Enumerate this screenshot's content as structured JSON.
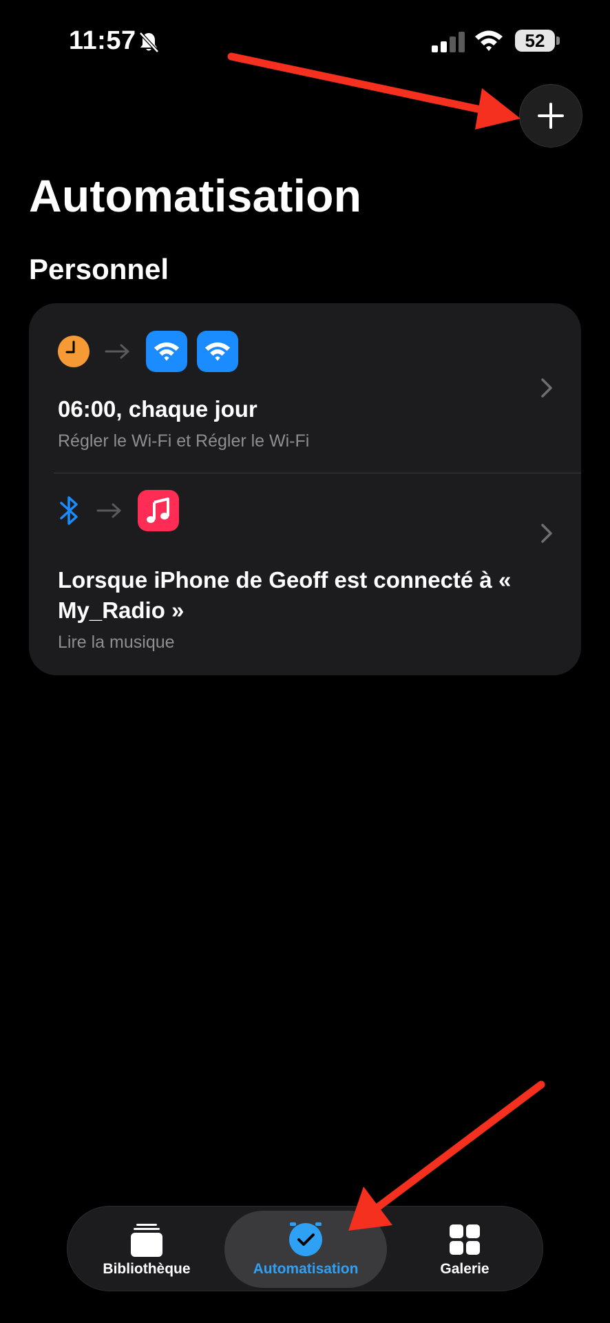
{
  "status_bar": {
    "time": "11:57",
    "battery": "52"
  },
  "header": {
    "title": "Automatisation",
    "add_icon": "plus-icon"
  },
  "section": {
    "title": "Personnel"
  },
  "automations": [
    {
      "title": "06:00, chaque jour",
      "subtitle": "Régler le Wi-Fi et Régler le Wi-Fi",
      "trigger_icon": "clock-icon",
      "action_icons": [
        "wifi-icon",
        "wifi-icon"
      ]
    },
    {
      "title": "Lorsque iPhone de Geoff est connecté à « My_Radio »",
      "subtitle": "Lire la musique",
      "trigger_icon": "bluetooth-icon",
      "action_icons": [
        "music-icon"
      ]
    }
  ],
  "tab_bar": {
    "tabs": [
      {
        "label": "Bibliothèque",
        "icon": "library-icon"
      },
      {
        "label": "Automatisation",
        "icon": "automation-icon",
        "selected": true
      },
      {
        "label": "Galerie",
        "icon": "gallery-icon"
      }
    ]
  },
  "colors": {
    "background": "#000000",
    "card": "#1c1c1e",
    "accent": "#2fa1f5",
    "clock": "#f59a35",
    "wifi_tile": "#1a8cff",
    "music_tile": "#ff2d55",
    "annotation_arrow": "#f5301e"
  }
}
